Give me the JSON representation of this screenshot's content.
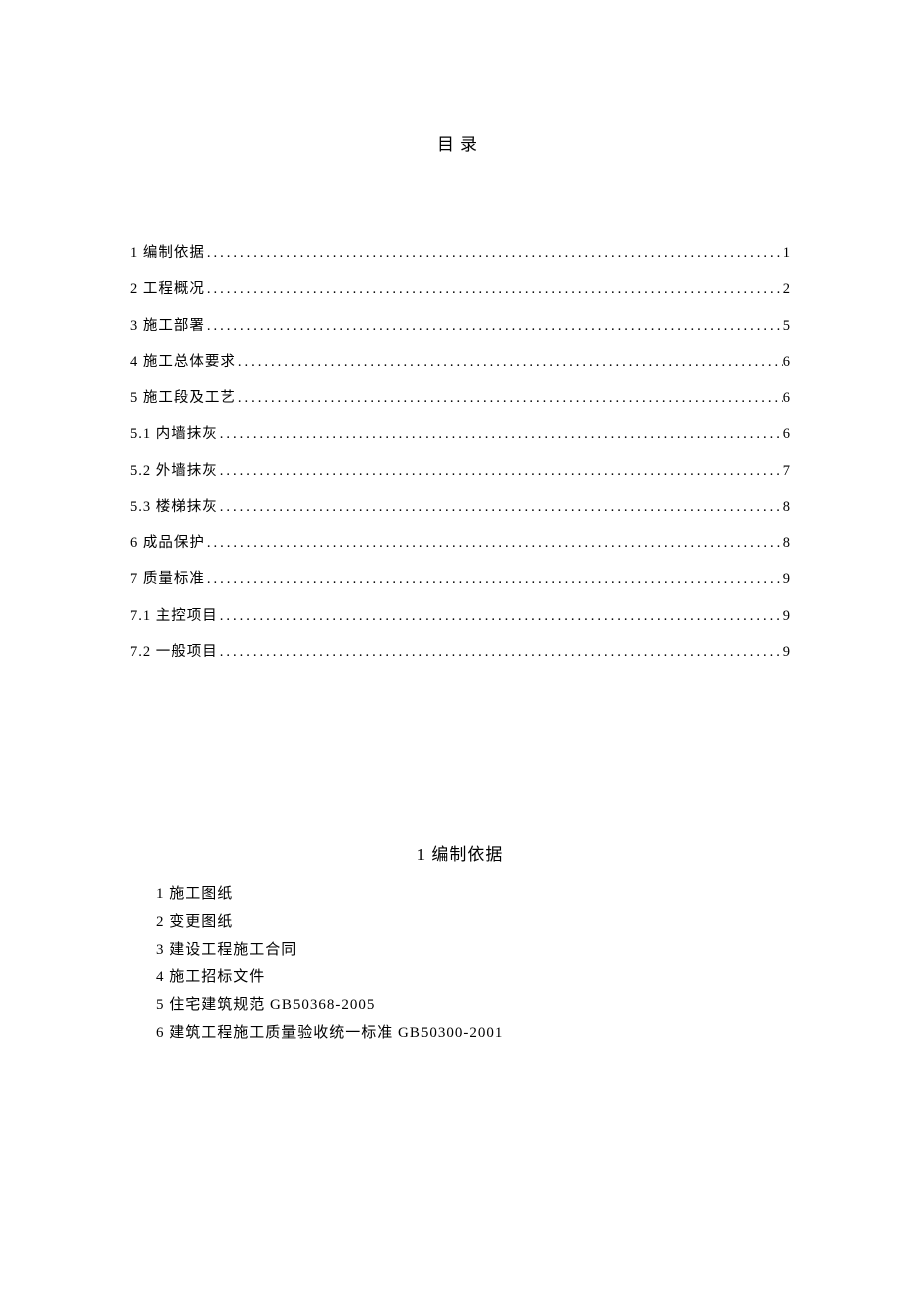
{
  "toc_title": "目录",
  "toc": [
    {
      "label": "1 编制依据",
      "page": "1"
    },
    {
      "label": "2 工程概况",
      "page": "2"
    },
    {
      "label": "3 施工部署",
      "page": "5"
    },
    {
      "label": "4 施工总体要求",
      "page": "6"
    },
    {
      "label": "5 施工段及工艺",
      "page": "6"
    },
    {
      "label": "5.1 内墙抹灰",
      "page": "6"
    },
    {
      "label": "5.2 外墙抹灰",
      "page": "7"
    },
    {
      "label": "5.3 楼梯抹灰",
      "page": "8"
    },
    {
      "label": "6 成品保护",
      "page": "8"
    },
    {
      "label": "7 质量标准",
      "page": "9"
    },
    {
      "label": "7.1 主控项目",
      "page": "9"
    },
    {
      "label": "7.2 一般项目",
      "page": "9"
    }
  ],
  "section1": {
    "heading": "1 编制依据",
    "items": [
      "1 施工图纸",
      "2 变更图纸",
      "3 建设工程施工合同",
      "4 施工招标文件",
      "5 住宅建筑规范 GB50368-2005",
      "6 建筑工程施工质量验收统一标准 GB50300-2001"
    ]
  }
}
